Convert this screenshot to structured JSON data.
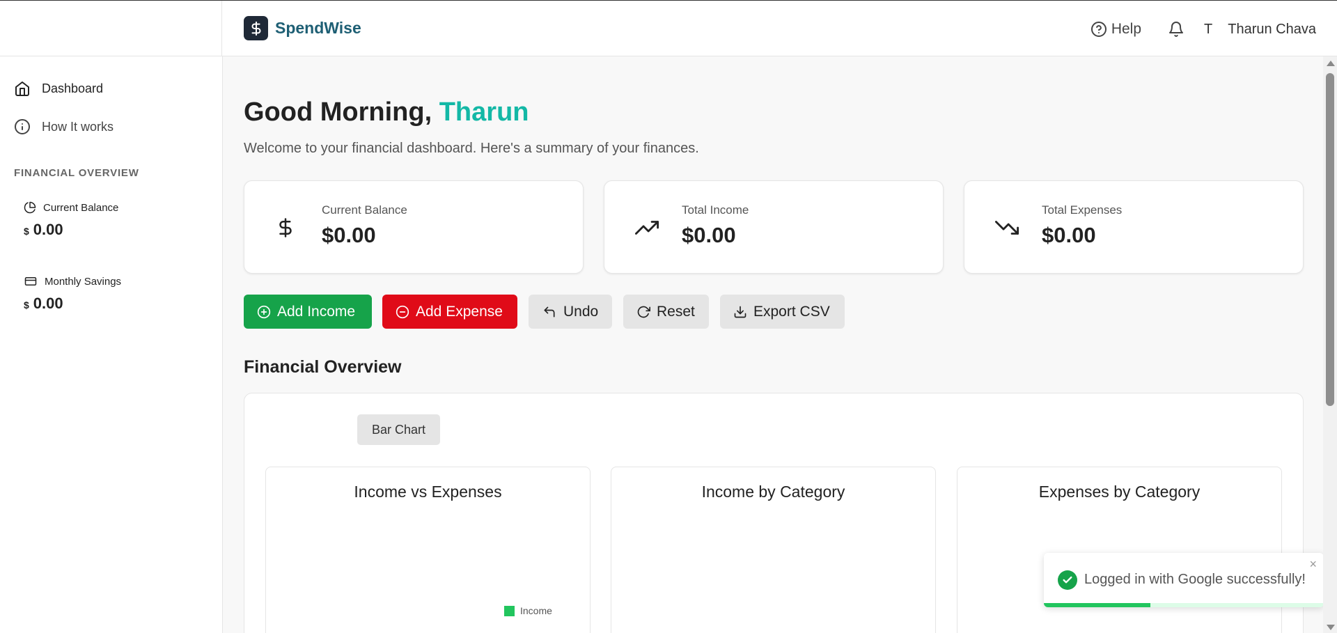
{
  "header": {
    "brand_name": "SpendWise",
    "help_label": "Help",
    "avatar_initial": "T",
    "user_name": "Tharun Chava"
  },
  "sidebar": {
    "items": [
      {
        "label": "Dashboard",
        "icon": "home-icon"
      },
      {
        "label": "How It works",
        "icon": "info-icon"
      }
    ],
    "section_title": "FINANCIAL OVERVIEW",
    "overview": [
      {
        "label": "Current Balance",
        "currency": "$",
        "value": "0.00",
        "icon": "pie-chart-icon"
      },
      {
        "label": "Monthly Savings",
        "currency": "$",
        "value": "0.00",
        "icon": "credit-card-icon"
      }
    ]
  },
  "main": {
    "greeting_prefix": "Good Morning,",
    "greeting_name": "Tharun",
    "subtitle": "Welcome to your financial dashboard. Here's a summary of your finances.",
    "cards": [
      {
        "label": "Current Balance",
        "value": "$0.00",
        "icon": "dollar-icon"
      },
      {
        "label": "Total Income",
        "value": "$0.00",
        "icon": "trending-up-icon"
      },
      {
        "label": "Total Expenses",
        "value": "$0.00",
        "icon": "trending-down-icon"
      }
    ],
    "actions": {
      "add_income": "Add Income",
      "add_expense": "Add Expense",
      "undo": "Undo",
      "reset": "Reset",
      "export_csv": "Export CSV"
    },
    "overview_title": "Financial Overview",
    "chart_toggle": "Bar Chart",
    "charts": [
      {
        "title": "Income vs Expenses"
      },
      {
        "title": "Income by Category"
      },
      {
        "title": "Expenses by Category"
      }
    ],
    "legend_income": "Income"
  },
  "toast": {
    "message": "Logged in with Google successfully!",
    "close": "×",
    "progress": 0.38
  },
  "colors": {
    "brand": "#1e5f74",
    "accent": "#14b8a6",
    "income": "#16a34a",
    "expense": "#e00b18"
  }
}
